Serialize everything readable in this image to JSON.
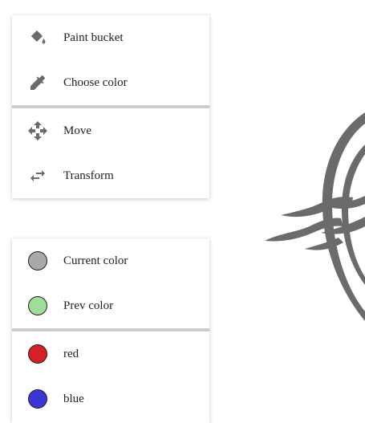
{
  "tools": {
    "items": [
      {
        "label": "Paint bucket",
        "icon": "paint-bucket-icon"
      },
      {
        "label": "Choose color",
        "icon": "eyedropper-icon"
      },
      {
        "label": "Move",
        "icon": "move-icon"
      },
      {
        "label": "Transform",
        "icon": "swap-arrows-icon"
      }
    ]
  },
  "colors": {
    "items": [
      {
        "label": "Current color",
        "color": "#a9a9a9"
      },
      {
        "label": "Prev color",
        "color": "#a0dc9a"
      },
      {
        "label": "red",
        "color": "#d42027"
      },
      {
        "label": "blue",
        "color": "#3a36d6"
      }
    ]
  },
  "canvas": {
    "art_color": "#6b6b6b"
  }
}
